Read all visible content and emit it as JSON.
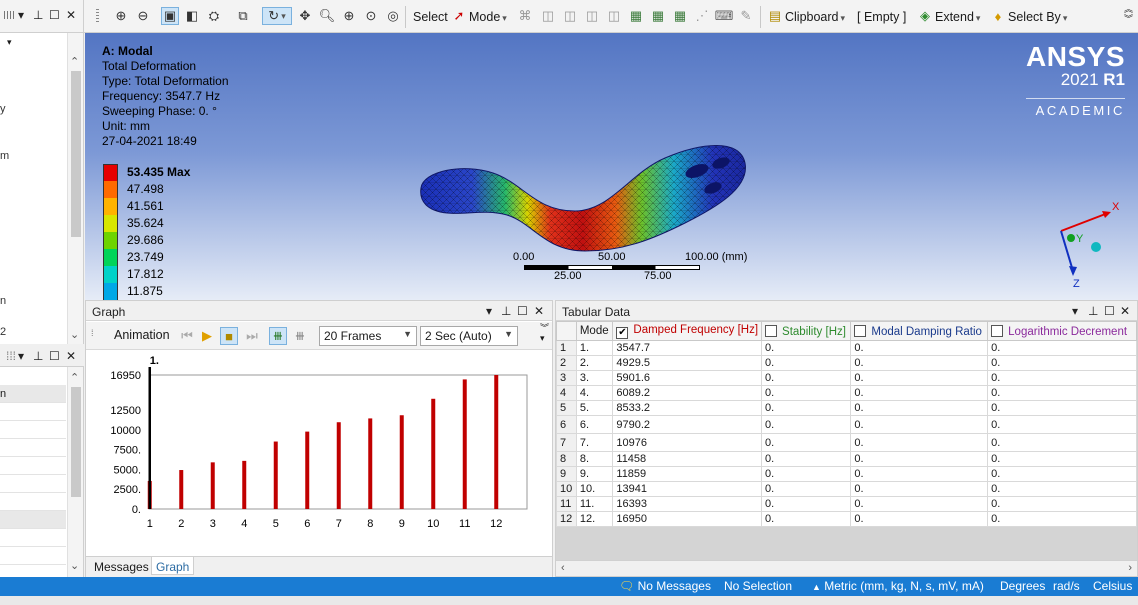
{
  "toolbar": {
    "select_label": "Select",
    "mode_label": "Mode",
    "clipboard_label": "Clipboard",
    "empty_label": "[ Empty ]",
    "extend_label": "Extend",
    "select_by_label": "Select By"
  },
  "viewport": {
    "info": {
      "title": "A: Modal",
      "result_name": "Total Deformation",
      "type": "Type: Total Deformation",
      "frequency": "Frequency: 3547.7 Hz",
      "sweeping_phase": "Sweeping Phase: 0. °",
      "unit": "Unit: mm",
      "timestamp": "27-04-2021 18:49"
    },
    "legend": {
      "items": [
        {
          "label": "53.435 Max",
          "color": "#e60000"
        },
        {
          "label": "47.498",
          "color": "#ff6a00"
        },
        {
          "label": "41.561",
          "color": "#ffb300"
        },
        {
          "label": "35.624",
          "color": "#d8e600"
        },
        {
          "label": "29.686",
          "color": "#6ed400"
        },
        {
          "label": "23.749",
          "color": "#00d45a"
        },
        {
          "label": "17.812",
          "color": "#00d2c8"
        },
        {
          "label": "11.875",
          "color": "#00a8e6"
        }
      ]
    },
    "brand": {
      "name": "ANSYS",
      "version": "2021",
      "release": "R1",
      "edition": "ACADEMIC"
    },
    "scale": {
      "l0": "0.00",
      "l50": "50.00",
      "l100": "100.00 (mm)",
      "l25": "25.00",
      "l75": "75.00"
    },
    "triad": {
      "x": "X",
      "y": "Y",
      "z": "Z"
    }
  },
  "graph_panel": {
    "title": "Graph",
    "animation_label": "Animation",
    "frames": "20 Frames",
    "duration": "2 Sec (Auto)",
    "tabs": [
      "Messages",
      "Graph"
    ]
  },
  "chart_data": {
    "type": "bar",
    "categories": [
      "1",
      "2",
      "3",
      "4",
      "5",
      "6",
      "7",
      "8",
      "9",
      "10",
      "11",
      "12"
    ],
    "values": [
      3547.7,
      4929.5,
      5901.6,
      6089.2,
      8533.2,
      9790.2,
      10976,
      11458,
      11859,
      13941,
      16393,
      16950
    ],
    "yticks": [
      "0.",
      "2500.",
      "5000.",
      "7500.",
      "10000",
      "12500",
      "16950"
    ],
    "ytick_values": [
      0,
      2500,
      5000,
      7500,
      10000,
      12500,
      16950
    ],
    "ylim": [
      0,
      16950
    ],
    "marker_label": "1.",
    "bar_color": "#c00000"
  },
  "tabular": {
    "title": "Tabular Data",
    "columns": [
      "Mode",
      "Damped Frequency [Hz]",
      "Stability [Hz]",
      "Modal Damping Ratio",
      "Logarithmic Decrement"
    ],
    "column_colors": [
      "#1a1a1a",
      "#c00000",
      "#2e8b2e",
      "#1a3a8c",
      "#8b2a9c"
    ],
    "rows": [
      [
        "1",
        "1.",
        "3547.7",
        "0.",
        "0.",
        "0."
      ],
      [
        "2",
        "2.",
        "4929.5",
        "0.",
        "0.",
        "0."
      ],
      [
        "3",
        "3.",
        "5901.6",
        "0.",
        "0.",
        "0."
      ],
      [
        "4",
        "4.",
        "6089.2",
        "0.",
        "0.",
        "0."
      ],
      [
        "5",
        "5.",
        "8533.2",
        "0.",
        "0.",
        "0."
      ],
      [
        "6",
        "6.",
        "9790.2",
        "0.",
        "0.",
        "0."
      ],
      [
        "7",
        "7.",
        "10976",
        "0.",
        "0.",
        "0."
      ],
      [
        "8",
        "8.",
        "11458",
        "0.",
        "0.",
        "0."
      ],
      [
        "9",
        "9.",
        "11859",
        "0.",
        "0.",
        "0."
      ],
      [
        "10",
        "10.",
        "13941",
        "0.",
        "0.",
        "0."
      ],
      [
        "11",
        "11.",
        "16393",
        "0.",
        "0.",
        "0."
      ],
      [
        "12",
        "12.",
        "16950",
        "0.",
        "0.",
        "0."
      ]
    ]
  },
  "statusbar": {
    "messages": "No Messages",
    "selection": "No Selection",
    "units": "Metric (mm, kg, N, s, mV, mA)",
    "angle": "Degrees",
    "rate": "rad/s",
    "temperature": "Celsius"
  }
}
